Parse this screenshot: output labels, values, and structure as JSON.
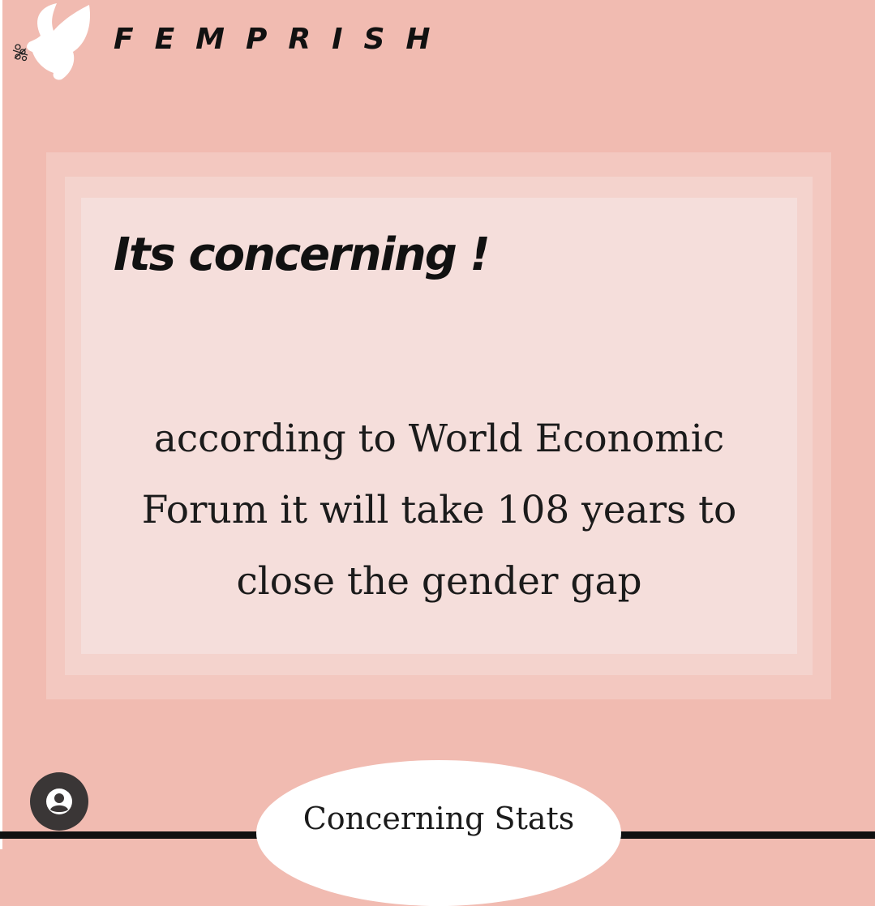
{
  "brand": {
    "name": "FEMPRISH",
    "logo_icon": "dove-icon"
  },
  "card": {
    "heading": "Its concerning !",
    "body_lines": [
      "according to World Economic",
      "Forum it will take 108 years to",
      "close the gender gap"
    ]
  },
  "footer": {
    "label": "Concerning Stats"
  },
  "overlay": {
    "profile_icon": "account-circle-icon"
  },
  "colors": {
    "background": "#f1bbb1",
    "frame_outer": "#f3c8c0",
    "frame_mid": "#f4d3cd",
    "frame_inner": "#f5dedb",
    "text": "#111111",
    "profile_button": "#3a3636"
  }
}
